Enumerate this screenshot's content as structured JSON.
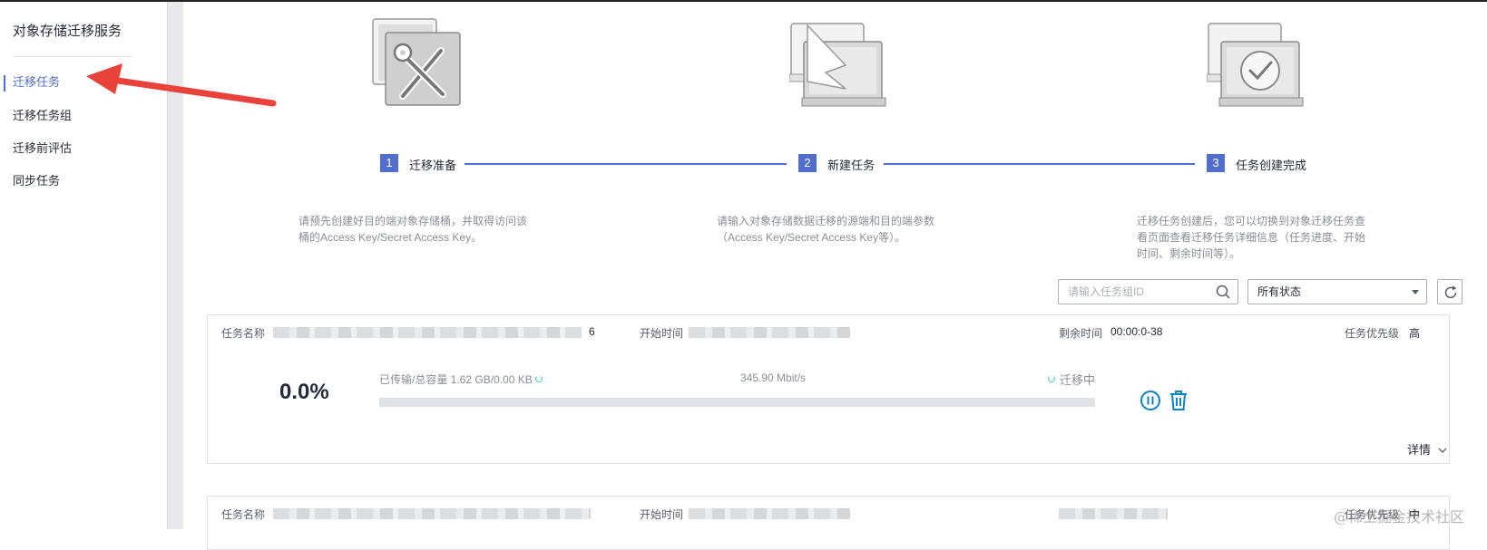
{
  "sidebar": {
    "title": "对象存储迁移服务",
    "items": [
      {
        "label": "迁移任务",
        "active": true
      },
      {
        "label": "迁移任务组",
        "active": false
      },
      {
        "label": "迁移前评估",
        "active": false
      },
      {
        "label": "同步任务",
        "active": false
      }
    ]
  },
  "steps": [
    {
      "num": "1",
      "label": "迁移准备",
      "icon": "tools-icon",
      "desc": [
        "请预先创建好目的端对象存储桶，并取得访问该",
        "桶的Access Key/Secret Access Key。"
      ]
    },
    {
      "num": "2",
      "label": "新建任务",
      "icon": "migrate-arrow-icon",
      "desc": [
        "请输入对象存储数据迁移的源端和目的端参数",
        "（Access Key/Secret Access Key等）。"
      ]
    },
    {
      "num": "3",
      "label": "任务创建完成",
      "icon": "check-circle-icon",
      "desc": [
        "迁移任务创建后，您可以切换到对象迁移任务查",
        "看页面查看迁移任务详细信息（任务进度、开始",
        "时间、剩余时间等）。"
      ]
    }
  ],
  "filter": {
    "search_placeholder": "请输入任务组ID",
    "status_value": "所有状态"
  },
  "tasks": [
    {
      "name_label": "任务名称",
      "name_suffix": "6",
      "start_label": "开始时间",
      "remaining_label": "剩余时间",
      "remaining_value": "00:00:0-38",
      "priority_label": "任务优先级",
      "priority_value": "高",
      "percent": "0.0%",
      "progress_fraction": 0.0,
      "transfer": "已传输/总容量 1.62 GB/0.00 KB",
      "speed": "345.90 Mbit/s",
      "status": "迁移中",
      "details": "详情"
    },
    {
      "name_label": "任务名称",
      "start_label": "开始时间",
      "priority_label": "任务优先级",
      "priority_value": "中"
    }
  ],
  "watermark": "@稀土掘金技术社区",
  "colors": {
    "accent": "#526ecc",
    "icon_blue": "#0e82c9",
    "spinner": "#50d4ab",
    "annotation_red": "#e8423b"
  }
}
